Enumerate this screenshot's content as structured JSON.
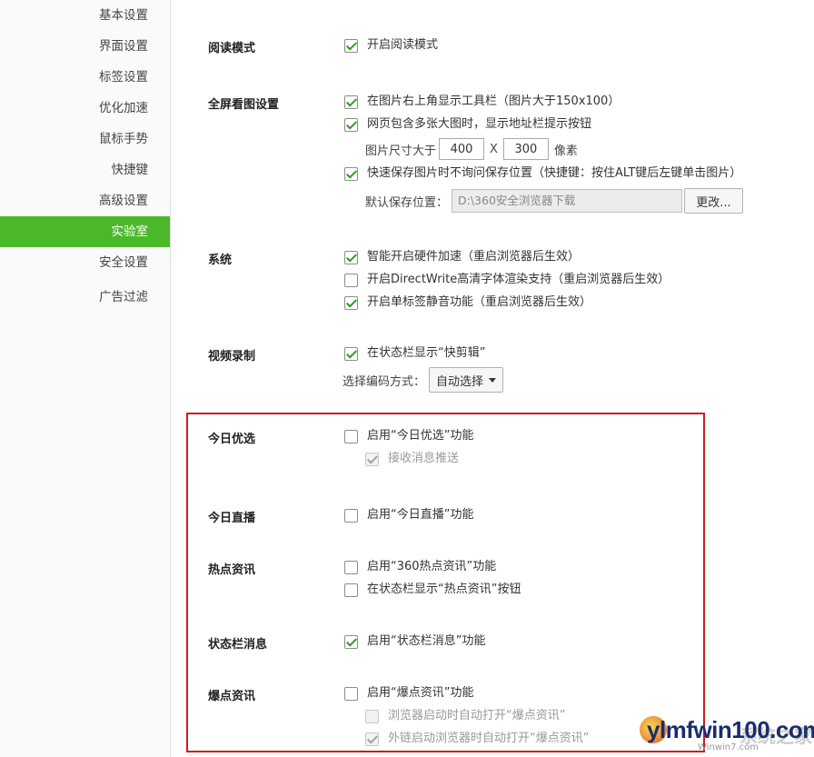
{
  "sidebar": {
    "items": [
      {
        "label": "基本设置"
      },
      {
        "label": "界面设置"
      },
      {
        "label": "标签设置"
      },
      {
        "label": "优化加速"
      },
      {
        "label": "鼠标手势"
      },
      {
        "label": "快捷键"
      },
      {
        "label": "高级设置"
      },
      {
        "label": "实验室",
        "active": true
      },
      {
        "label": "安全设置"
      },
      {
        "label": "广告过滤"
      }
    ]
  },
  "reading": {
    "title": "阅读模式",
    "enable": {
      "label": "开启阅读模式",
      "checked": true
    }
  },
  "fullscreen": {
    "title": "全屏看图设置",
    "toolbar": {
      "label": "在图片右上角显示工具栏（图片大于150x100）",
      "checked": true
    },
    "addressbar": {
      "label": "网页包含多张大图时，显示地址栏提示按钮",
      "checked": true
    },
    "size_label": "图片尺寸大于",
    "width": "400",
    "x": "X",
    "height": "300",
    "unit": "像素",
    "quicksave": {
      "label": "快速保存图片时不询问保存位置（快捷键：按住ALT键后左键单击图片）",
      "checked": true
    },
    "save_path_label": "默认保存位置：",
    "save_path": "D:\\360安全浏览器下载",
    "change_button": "更改..."
  },
  "system": {
    "title": "系统",
    "hw_accel": {
      "label": "智能开启硬件加速（重启浏览器后生效）",
      "checked": true
    },
    "directwrite": {
      "label": "开启DirectWrite高清字体渲染支持（重启浏览器后生效）",
      "checked": false
    },
    "tab_mute": {
      "label": "开启单标签静音功能（重启浏览器后生效）",
      "checked": true
    }
  },
  "video": {
    "title": "视频录制",
    "statusbar": {
      "label": "在状态栏显示“快剪辑”",
      "checked": true
    },
    "codec_label": "选择编码方式：",
    "codec_value": "自动选择"
  },
  "today_pick": {
    "title": "今日优选",
    "enable": {
      "label": "启用“今日优选”功能",
      "checked": false
    },
    "push": {
      "label": "接收消息推送",
      "checked": true,
      "disabled": true
    }
  },
  "today_live": {
    "title": "今日直播",
    "enable": {
      "label": "启用“今日直播”功能",
      "checked": false
    }
  },
  "hot_news": {
    "title": "热点资讯",
    "enable": {
      "label": "启用“360热点资讯”功能",
      "checked": false
    },
    "statusbar_btn": {
      "label": "在状态栏显示“热点资讯”按钮",
      "checked": false
    }
  },
  "status_msg": {
    "title": "状态栏消息",
    "enable": {
      "label": "启用“状态栏消息”功能",
      "checked": true
    }
  },
  "burst_news": {
    "title": "爆点资讯",
    "enable": {
      "label": "启用“爆点资讯”功能",
      "checked": false
    },
    "auto_open": {
      "label": "浏览器启动时自动打开“爆点资讯”",
      "checked": false,
      "disabled": true
    },
    "external_open": {
      "label": "外链启动浏览器时自动打开“爆点资讯”",
      "checked": true,
      "disabled": true
    }
  },
  "watermark": {
    "text": "ylmfwin100.com",
    "sub": "Winwin7.com",
    "cjk": "系统之家"
  }
}
